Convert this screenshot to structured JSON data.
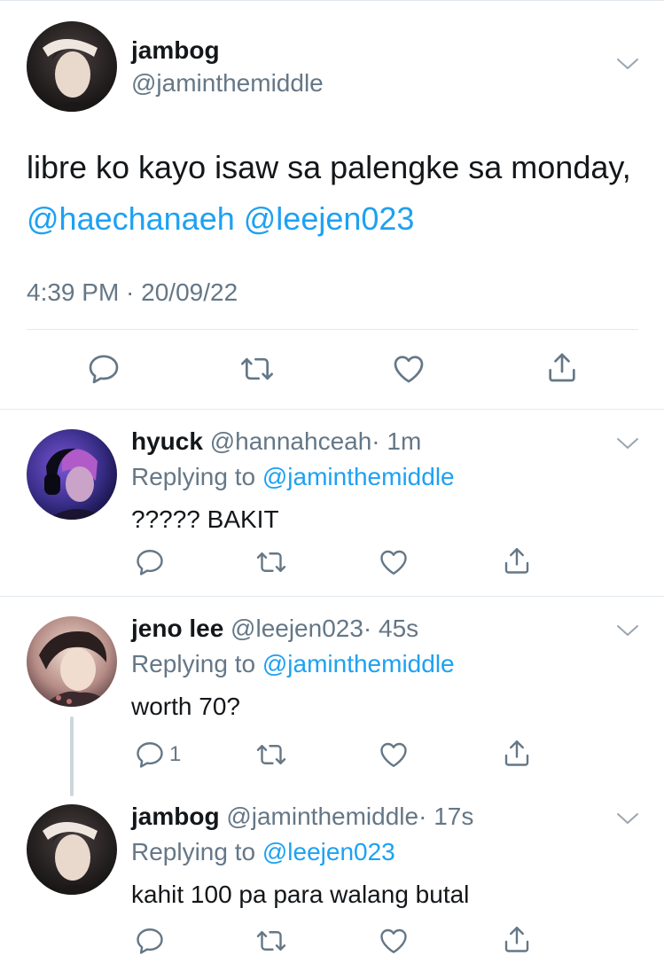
{
  "main_tweet": {
    "name": "jambog",
    "handle": "@jaminthemiddle",
    "text_plain": "libre ko kayo isaw sa palengke sa monday, ",
    "mentions": [
      "@haechanaeh",
      "@leejen023"
    ],
    "timestamp": "4:39 PM · 20/09/22"
  },
  "replies": [
    {
      "name": "hyuck",
      "handle": "@hannahceah",
      "time": "· 1m",
      "replying_label": "Replying to",
      "replying_to": "@jaminthemiddle",
      "text": "????? BAKIT",
      "reply_count": ""
    },
    {
      "name": "jeno lee",
      "handle": "@leejen023",
      "time": "· 45s",
      "replying_label": "Replying to",
      "replying_to": "@jaminthemiddle",
      "text": "worth 70?",
      "reply_count": "1"
    },
    {
      "name": "jambog",
      "handle": "@jaminthemiddle",
      "time": "· 17s",
      "replying_label": "Replying to",
      "replying_to": "@leejen023",
      "text": "kahit 100 pa para walang butal",
      "reply_count": ""
    }
  ],
  "icons": [
    "reply-icon",
    "retweet-icon",
    "like-icon",
    "share-icon",
    "chevron-down-icon"
  ],
  "colors": {
    "accent": "#1da1f2",
    "secondary_text": "#657786",
    "divider": "#e1e8ed",
    "icon": "#657786"
  }
}
